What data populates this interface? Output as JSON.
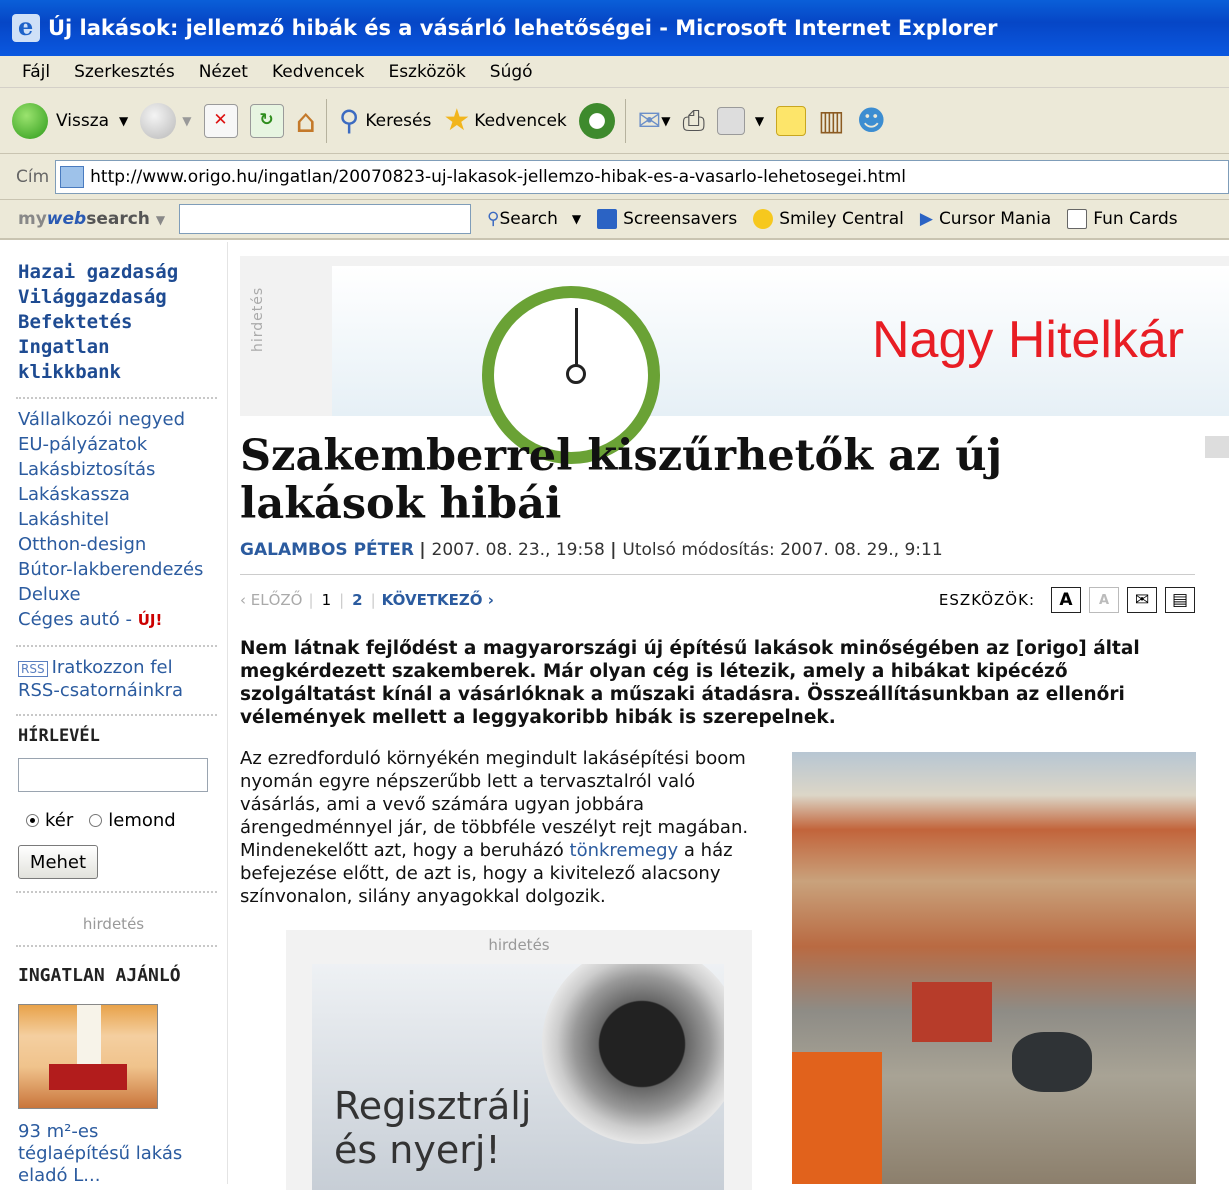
{
  "window": {
    "title": "Új lakások: jellemző hibák és a vásárló lehetőségei - Microsoft Internet Explorer"
  },
  "menu": [
    "Fájl",
    "Szerkesztés",
    "Nézet",
    "Kedvencek",
    "Eszközök",
    "Súgó"
  ],
  "toolbar": {
    "back": "Vissza",
    "search": "Keresés",
    "favorites": "Kedvencek"
  },
  "address": {
    "label": "Cím",
    "url": "http://www.origo.hu/ingatlan/20070823-uj-lakasok-jellemzo-hibak-es-a-vasarlo-lehetosegei.html"
  },
  "websearch": {
    "logo_plain": "my",
    "logo_bold": "web",
    "logo_tail": "search",
    "search": "Search",
    "screensavers": "Screensavers",
    "smiley": "Smiley Central",
    "cursor": "Cursor Mania",
    "funcards": "Fun Cards"
  },
  "nav": {
    "main": [
      "Hazai gazdaság",
      "Világgazdaság",
      "Befektetés",
      "Ingatlan",
      "klikkbank"
    ],
    "sub": [
      "Vállalkozói negyed",
      "EU-pályázatok",
      "Lakásbiztosítás",
      "Lakáskassza",
      "Lakáshitel",
      "Otthon-design",
      "Bútor-lakberendezés",
      "Deluxe"
    ],
    "ceges": "Céges autó",
    "uj": "ÚJ!",
    "rss_badge": "RSS",
    "rss_line1": "Iratkozzon fel",
    "rss_line2": "RSS-csatornáinkra",
    "hirlevel": "HÍRLEVÉL",
    "ker": "kér",
    "lemond": "lemond",
    "mehet": "Mehet",
    "hirdetes": "hirdetés",
    "ajanlo": "INGATLAN AJÁNLÓ",
    "listing1": "93 m²-es",
    "listing2": "téglaépítésű lakás",
    "listing3": "eladó L..."
  },
  "ad_top": {
    "label": "hirdetés",
    "slogan": "Nagy Hitelkár"
  },
  "article": {
    "title": "Szakemberrel kiszűrhetők az új lakások hibái",
    "author": "GALAMBOS PÉTER",
    "date": "2007. 08. 23., 19:58",
    "modified": "Utolsó módosítás: 2007. 08. 29., 9:11",
    "prev": "‹ ELŐZŐ",
    "page1": "1",
    "page2": "2",
    "next": "KÖVETKEZŐ ›",
    "tools_label": "ESZKÖZÖK:",
    "lead": "Nem látnak fejlődést a magyarországi új építésű lakások minőségében az [origo] által megkérdezett szakemberek. Már olyan cég is létezik, amely a hibákat kipécéző szolgáltatást kínál a vásárlóknak a műszaki átadásra. Összeállításunkban az ellenőri vélemények mellett a leggyakoribb hibák is szerepelnek.",
    "body1": "Az ezredforduló környékén megindult lakásépítési boom nyomán egyre népszerűbb lett a tervasztalról való vásárlás, ami a vevő számára ugyan jobbára árengedménnyel jár, de többféle veszélyt rejt magában. Mindenekelőtt azt, hogy a beruházó ",
    "body_link": "tönkremegy",
    "body2": " a ház befejezése előtt, de azt is, hogy a kivitelező alacsony színvonalon, silány anyagokkal dolgozik.",
    "ad_label": "hirdetés",
    "ad_text1": "Regisztrálj",
    "ad_text2": "és nyerj!"
  }
}
